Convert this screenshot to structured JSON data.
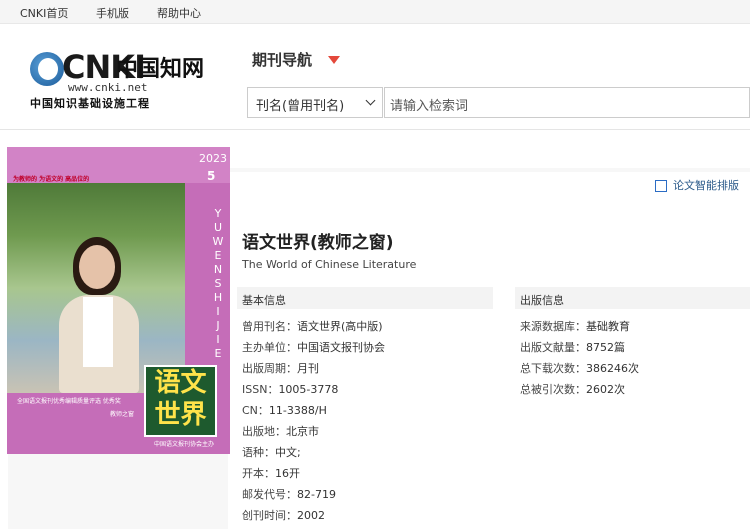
{
  "topbar": {
    "links": [
      "CNKI首页",
      "手机版",
      "帮助中心"
    ]
  },
  "logo": {
    "brand": "CNKI",
    "brand_cn": "中国知网",
    "url": "www.cnki.net",
    "subtitle": "中国知识基础设施工程"
  },
  "nav": {
    "title": "期刊导航"
  },
  "search": {
    "field_select": "刊名(曾用刊名)",
    "placeholder": "请输入检索词"
  },
  "cover": {
    "year": "2023",
    "issue": "5",
    "slogans": "为教师的  为语文的  高品位的",
    "vertical_title": "YUWENSHIJIE",
    "title_line1": "语文",
    "title_line2": "世界",
    "banner": "全国语文报刊优秀编辑质量评选 优秀奖",
    "edition": "教师之窗",
    "footer": "中国语文报刊协会主办"
  },
  "toolbar": {
    "smart_sort": "论文智能排版"
  },
  "journal": {
    "title": "语文世界(教师之窗)",
    "english_title": "The World of Chinese Literature",
    "basic_info_heading": "基本信息",
    "publish_info_heading": "出版信息",
    "basic_info": [
      {
        "label": "曾用刊名：",
        "value": "语文世界(高中版)"
      },
      {
        "label": "主办单位：",
        "value": "中国语文报刊协会"
      },
      {
        "label": "出版周期：",
        "value": "月刊"
      },
      {
        "label": "ISSN：",
        "value": "1005-3778"
      },
      {
        "label": "CN：",
        "value": "11-3388/H"
      },
      {
        "label": "出版地：",
        "value": "北京市"
      },
      {
        "label": "语种：",
        "value": "中文;"
      },
      {
        "label": "开本：",
        "value": "16开"
      },
      {
        "label": "邮发代号：",
        "value": "82-719"
      },
      {
        "label": "创刊时间：",
        "value": "2002"
      }
    ],
    "publish_info": [
      {
        "label": "来源数据库：",
        "value": "基础教育"
      },
      {
        "label": "出版文献量：",
        "value": "8752篇"
      },
      {
        "label": "总下载次数：",
        "value": "386246次"
      },
      {
        "label": "总被引次数：",
        "value": "2602次"
      }
    ]
  }
}
